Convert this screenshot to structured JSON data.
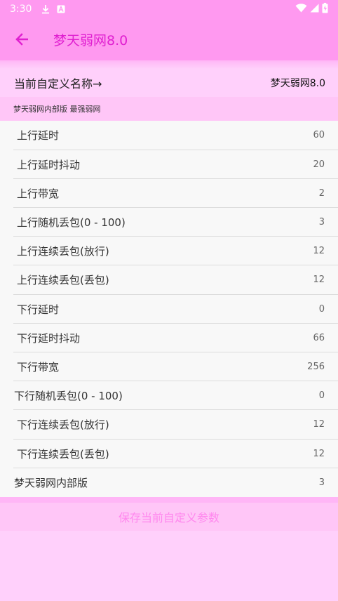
{
  "status_bar": {
    "time": "3:30",
    "icons": [
      "download-icon",
      "a-letter-icon",
      "wifi-icon",
      "signal-icon",
      "battery-icon"
    ]
  },
  "app_bar": {
    "title": "梦天弱网8.0",
    "back_icon": "arrow-left-icon"
  },
  "current": {
    "label": "当前自定义名称→",
    "value": "梦天弱网8.0"
  },
  "subtitle": "梦天弱网内部版  最强弱网",
  "settings": [
    {
      "label": "上行延时",
      "value": "60"
    },
    {
      "label": "上行延时抖动",
      "value": "20"
    },
    {
      "label": "上行带宽",
      "value": "2"
    },
    {
      "label": "上行随机丢包(0 - 100)",
      "value": "3"
    },
    {
      "label": "上行连续丢包(放行)",
      "value": "12"
    },
    {
      "label": "上行连续丢包(丢包)",
      "value": "12"
    },
    {
      "label": "下行延时",
      "value": "0"
    },
    {
      "label": "下行延时抖动",
      "value": "66"
    },
    {
      "label": "下行带宽",
      "value": "256"
    },
    {
      "label": "下行随机丢包(0 - 100)",
      "value": "0"
    },
    {
      "label": "下行连续丢包(放行)",
      "value": "12"
    },
    {
      "label": "下行连续丢包(丢包)",
      "value": "12"
    },
    {
      "label": "梦天弱网内部版",
      "value": "3"
    }
  ],
  "save_button": "保存当前自定义参数",
  "colors": {
    "accent": "#ff99f0",
    "title": "#e020d0",
    "background": "#ffd0fb",
    "button_text": "#ff88ee"
  }
}
